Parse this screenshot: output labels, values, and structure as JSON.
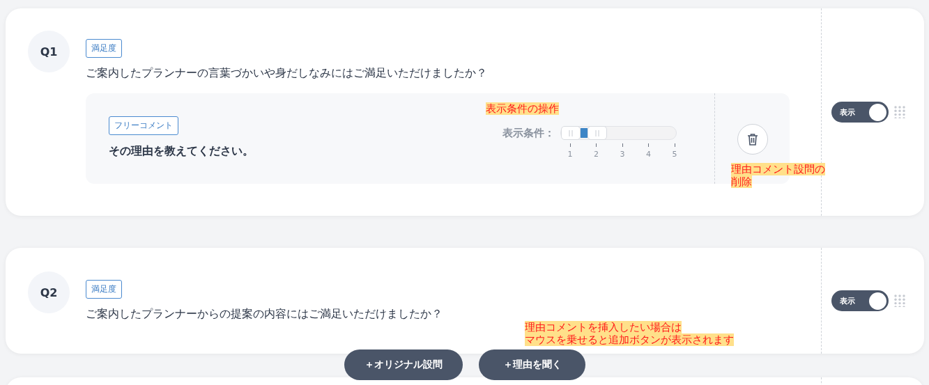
{
  "questions": [
    {
      "number": "Q1",
      "tag": "満足度",
      "text": "ご案内したプランナーの言葉づかいや身だしなみにはご満足いただけましたか？",
      "toggle": {
        "label": "表示",
        "on": true
      },
      "reason": {
        "tag": "フリーコメント",
        "text": "その理由を教えてください。",
        "condition_label": "表示条件：",
        "level": 0.25,
        "scale": [
          "1",
          "2",
          "3",
          "4",
          "5"
        ]
      }
    },
    {
      "number": "Q2",
      "tag": "満足度",
      "text": "ご案内したプランナーからの提案の内容にはご満足いただけましたか？",
      "toggle": {
        "label": "表示",
        "on": true
      }
    }
  ],
  "add_buttons": [
    "＋オリジナル設問",
    "＋理由を聞く"
  ],
  "annotations": [
    [
      "表示条件の操作"
    ],
    [
      "理由コメント設問の",
      "削除"
    ],
    [
      "理由コメントを挿入したい場合は",
      "マウスを乗せると追加ボタンが表示されます"
    ]
  ]
}
